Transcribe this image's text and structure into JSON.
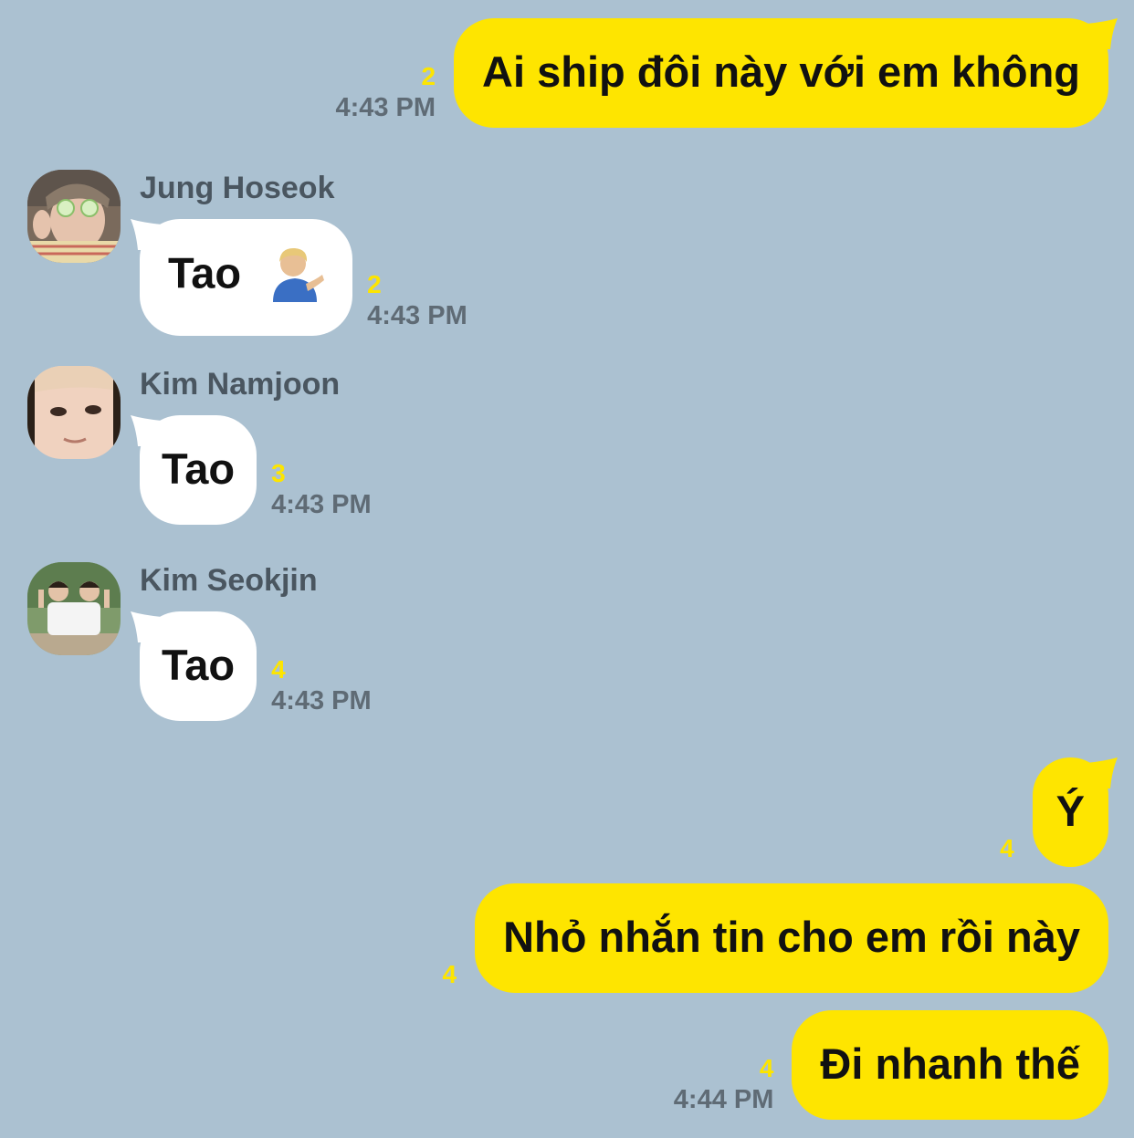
{
  "colors": {
    "background": "#abc1d1",
    "my_bubble": "#fee500",
    "their_bubble": "#ffffff",
    "unread": "#fde500",
    "time": "#5f6b75"
  },
  "messages": {
    "m1": {
      "text": "Ai ship đôi này với em không",
      "unread": "2",
      "time": "4:43 PM"
    },
    "m2": {
      "sender": "Jung Hoseok",
      "text": "Tao",
      "emoji": "person-tipping-hand-emoji",
      "unread": "2",
      "time": "4:43 PM"
    },
    "m3": {
      "sender": "Kim Namjoon",
      "text": "Tao",
      "unread": "3",
      "time": "4:43 PM"
    },
    "m4": {
      "sender": "Kim Seokjin",
      "text": "Tao",
      "unread": "4",
      "time": "4:43 PM"
    },
    "m5": {
      "text": "Ý",
      "unread": "4"
    },
    "m6": {
      "text": "Nhỏ nhắn tin cho em rồi này",
      "unread": "4"
    },
    "m7": {
      "text": "Đi nhanh thế",
      "unread": "4",
      "time": "4:44 PM"
    }
  }
}
